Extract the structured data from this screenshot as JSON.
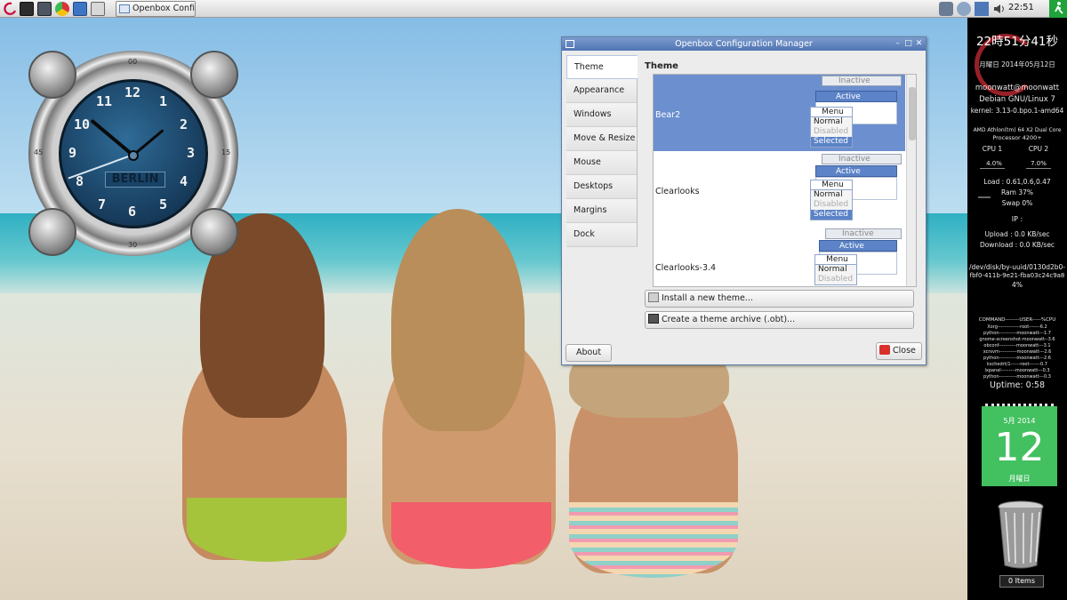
{
  "taskbar": {
    "launchers": [
      "debian-menu-icon",
      "terminal-icon",
      "monitor-icon",
      "chrome-icon",
      "files-icon",
      "screenshot-icon"
    ],
    "active_task": "Openbox Config…",
    "tray_icons": [
      "network-icon",
      "network-manager-icon",
      "weather-icon",
      "volume-icon"
    ],
    "clock": "22:51",
    "exit_icon": "exit-icon"
  },
  "analog_clock": {
    "numbers": [
      "12",
      "1",
      "2",
      "3",
      "4",
      "5",
      "6",
      "7",
      "8",
      "9",
      "10",
      "11"
    ],
    "bezel_marks": [
      "00",
      "15",
      "30",
      "45"
    ],
    "city": "BERLIN"
  },
  "ob_window": {
    "title": "Openbox Configuration Manager",
    "nav": [
      "Theme",
      "Appearance",
      "Windows",
      "Move & Resize",
      "Mouse",
      "Desktops",
      "Margins",
      "Dock"
    ],
    "selected_nav": "Theme",
    "heading": "Theme",
    "themes": [
      {
        "name": "Bear2",
        "selected": true
      },
      {
        "name": "Clearlooks",
        "selected": false
      },
      {
        "name": "Clearlooks-3.4",
        "selected": false
      }
    ],
    "preview": {
      "inactive": "Inactive",
      "active": "Active",
      "menu_title": "Menu",
      "menu_normal": "Normal",
      "menu_disabled": "Disabled",
      "menu_selected": "Selected"
    },
    "install_button": "Install a new theme...",
    "archive_button": "Create a theme archive (.obt)...",
    "about_button": "About",
    "close_button": "Close"
  },
  "conky": {
    "time_jp": "22時51分41秒",
    "date_jp": "月曜日 2014年05月12日",
    "user_host": "moonwatt@moonwatt",
    "os": "Debian GNU/Linux 7",
    "kernel": "kernel: 3.13-0.bpo.1-amd64",
    "cpu_model_1": "AMD Athlon(tm) 64 X2 Dual Core",
    "cpu_model_2": "Processor 4200+",
    "cpu1_label": "CPU 1",
    "cpu2_label": "CPU 2",
    "cpu1_value": "4.0%",
    "cpu2_value": "7.0%",
    "load": "Load : 0.61,0.6,0.47",
    "ram": "Ram 37%",
    "swap": "Swap 0%",
    "ip": "IP :",
    "upload": "Upload : 0.0 KB/sec",
    "download": "Download : 0.0 KB/sec",
    "disk_1": "/dev/disk/by-uuid/0130d2b0-",
    "disk_2": "fbf0-411b-9e21-fba03c24c9a8",
    "disk_3": "4%",
    "proc_header": "COMMAND--------USER-----%CPU",
    "processes": [
      "Xorg--------------root-------6.2",
      "python-----------moonwatt---1.7",
      "gnome-screenshot-moonwatt--3.6",
      "obconf-----------moonwatt---3.1",
      "xcrsvm-----------moonwatt---2.6",
      "python-----------moonwatt---2.6",
      "kschedrt/1------root-------0.7",
      "lxpanel---------moonwatt---0.3",
      "python-----------moonwatt---0.3"
    ],
    "uptime": "Uptime: 0:58",
    "calendar_month": "5月 2014",
    "calendar_day": "12",
    "calendar_weekday": "月曜日",
    "trash_items": "0 Items",
    "accent_red": "#b3262e",
    "calendar_green": "#43c060"
  }
}
